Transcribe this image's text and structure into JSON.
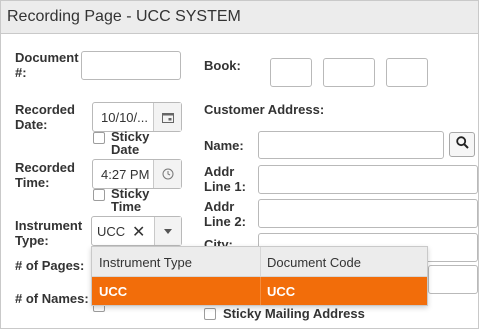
{
  "window": {
    "title": "Recording Page - UCC SYSTEM"
  },
  "form": {
    "document_label": "Document #:",
    "document_value": "",
    "recorded_date_label": "Recorded Date:",
    "recorded_date_value": "10/10/...",
    "sticky_date_label": "Sticky Date",
    "recorded_time_label": "Recorded Time:",
    "recorded_time_value": "4:27 PM",
    "sticky_time_label": "Sticky Time",
    "instrument_type_label": "Instrument Type:",
    "instrument_type_value": "UCC",
    "num_pages_label": "# of Pages:",
    "num_names_label": "# of Names:",
    "book_label": "Book:",
    "customer_address_label": "Customer Address:",
    "name_label": "Name:",
    "addr1_label": "Addr Line 1:",
    "addr2_label": "Addr Line 2:",
    "city_label": "City:",
    "sticky_mailing_label": "Sticky Mailing Address"
  },
  "instrument_dropdown": {
    "columns": [
      "Instrument Type",
      "Document Code"
    ],
    "rows": [
      {
        "instrument_type": "UCC",
        "document_code": "UCC"
      }
    ],
    "highlight_color": "#f26d0a"
  },
  "icons": {
    "date_picker": "calendar-icon",
    "time_picker": "clock-icon",
    "clear": "close-icon",
    "dropdown": "caret-down-icon",
    "name_search": "search-icon"
  }
}
